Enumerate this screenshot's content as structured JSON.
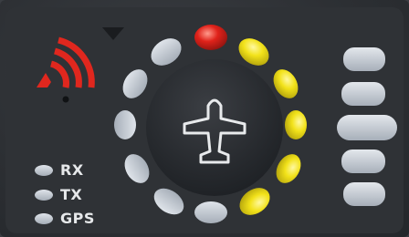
{
  "panel": {
    "indicators": [
      {
        "label": "RX"
      },
      {
        "label": "TX"
      },
      {
        "label": "GPS"
      }
    ],
    "ring_leds": [
      {
        "position": "top",
        "state": "red"
      },
      {
        "position": "upper-right-1",
        "state": "yellow"
      },
      {
        "position": "upper-right-2",
        "state": "yellow"
      },
      {
        "position": "right",
        "state": "yellow"
      },
      {
        "position": "lower-right-1",
        "state": "yellow"
      },
      {
        "position": "lower-right-2",
        "state": "yellow"
      },
      {
        "position": "bottom",
        "state": "off"
      },
      {
        "position": "lower-left-2",
        "state": "off"
      },
      {
        "position": "lower-left-1",
        "state": "off"
      },
      {
        "position": "left",
        "state": "off"
      },
      {
        "position": "upper-left-2",
        "state": "off"
      },
      {
        "position": "upper-left-1",
        "state": "off"
      }
    ],
    "side_buttons": 5,
    "center_icon": "airplane-icon",
    "signal_icon": "signal-waves-icon",
    "colors": {
      "body": "#2f3236",
      "led_off": "#bfc6cf",
      "led_yellow": "#f2e21a",
      "led_red": "#e0221a",
      "signal": "#e0271e",
      "label": "#e6e8ea"
    }
  }
}
